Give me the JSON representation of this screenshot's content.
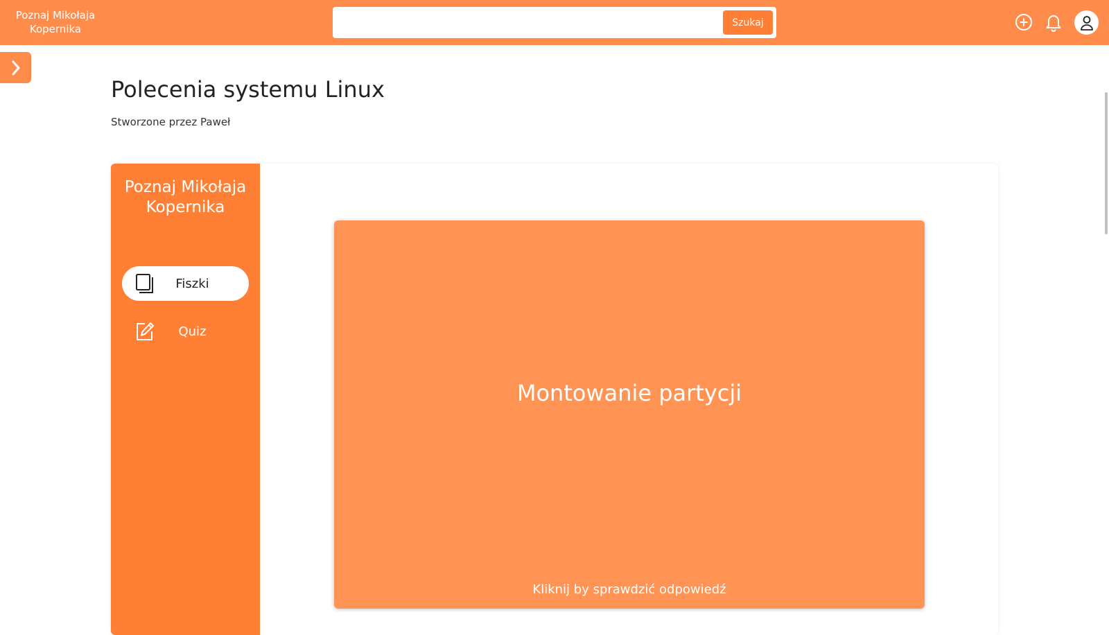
{
  "header": {
    "brand": "Poznaj Mikołaja Kopernika",
    "search": {
      "placeholder": "",
      "value": "",
      "button_label": "Szukaj"
    },
    "icons": [
      "add-circle-icon",
      "bell-icon",
      "user-icon"
    ]
  },
  "sidebar_toggle": {
    "icon": "chevron-right-icon"
  },
  "page": {
    "title": "Polecenia systemu Linux",
    "creator": "Stworzone przez Paweł"
  },
  "panel": {
    "side_title": "Poznaj Mikołaja Kopernika",
    "menu": [
      {
        "label": "Fiszki",
        "icon": "flashcards-icon",
        "active": true
      },
      {
        "label": "Quiz",
        "icon": "edit-icon",
        "active": false
      }
    ]
  },
  "flashcard": {
    "text": "Montowanie partycji",
    "hint": "Kliknij by sprawdzić odpowiedź"
  },
  "colors": {
    "topbar": "#ff8c4a",
    "panel_side": "#ff8034",
    "card": "#ff9455",
    "search_button": "#ff7f36"
  }
}
